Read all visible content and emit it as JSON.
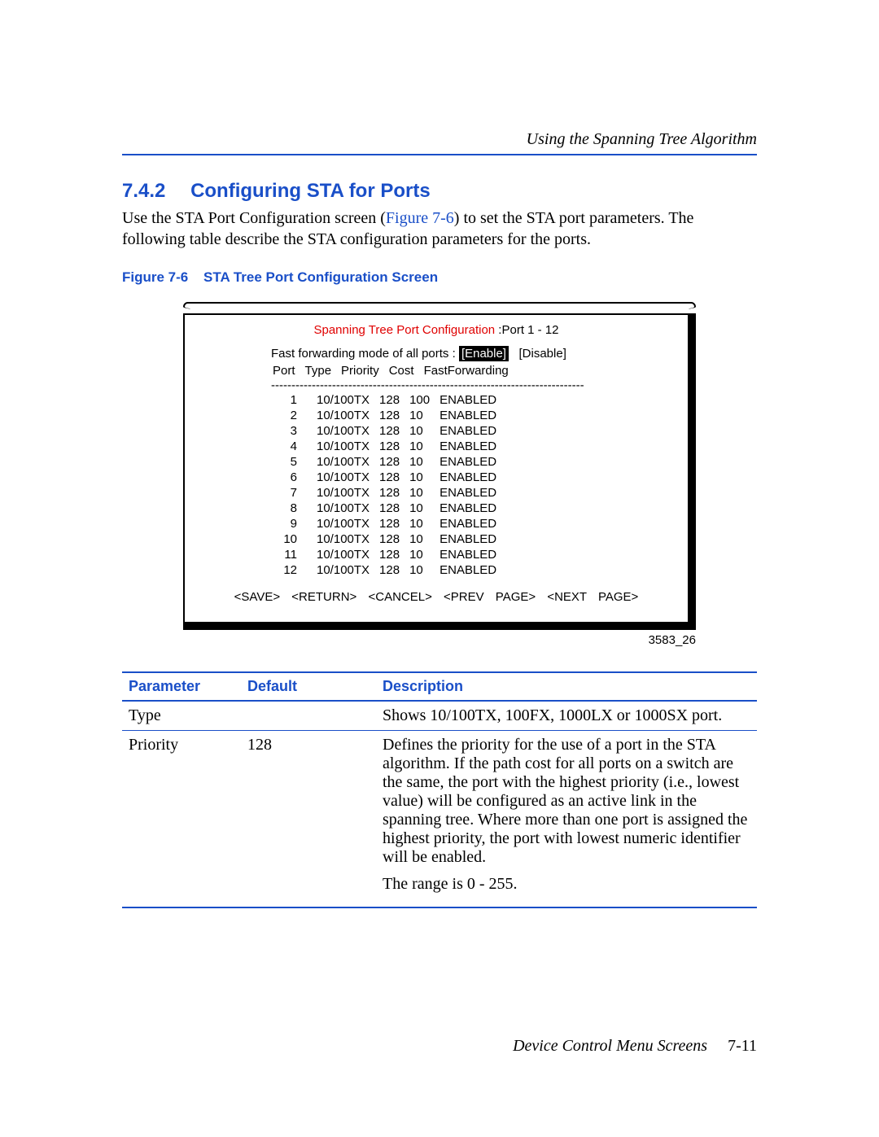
{
  "header": {
    "running": "Using the Spanning Tree Algorithm"
  },
  "section": {
    "number": "7.4.2",
    "title": "Configuring STA for Ports",
    "intro_pre": "Use the STA Port Configuration screen (",
    "intro_ref": "Figure 7-6",
    "intro_post": ") to set the STA port parameters. The following table describe the STA configuration parameters for the ports."
  },
  "figure": {
    "label_num": "Figure 7-6",
    "label_title": "STA Tree Port Configuration Screen",
    "title_red": "Spanning Tree Port Configuration",
    "title_suffix": " :Port  1 - 12",
    "ff_label": "Fast forwarding mode of all ports : ",
    "ff_enable": "[Enable]",
    "ff_disable": "[Disable]",
    "columns": [
      "Port",
      "Type",
      "Priority",
      "Cost",
      "FastForwarding"
    ],
    "rows": [
      {
        "port": "1",
        "type": "10/100TX",
        "priority": "128",
        "cost": "100",
        "ff": "ENABLED"
      },
      {
        "port": "2",
        "type": "10/100TX",
        "priority": "128",
        "cost": "10",
        "ff": "ENABLED"
      },
      {
        "port": "3",
        "type": "10/100TX",
        "priority": "128",
        "cost": "10",
        "ff": "ENABLED"
      },
      {
        "port": "4",
        "type": "10/100TX",
        "priority": "128",
        "cost": "10",
        "ff": "ENABLED"
      },
      {
        "port": "5",
        "type": "10/100TX",
        "priority": "128",
        "cost": "10",
        "ff": "ENABLED"
      },
      {
        "port": "6",
        "type": "10/100TX",
        "priority": "128",
        "cost": "10",
        "ff": "ENABLED"
      },
      {
        "port": "7",
        "type": "10/100TX",
        "priority": "128",
        "cost": "10",
        "ff": "ENABLED"
      },
      {
        "port": "8",
        "type": "10/100TX",
        "priority": "128",
        "cost": "10",
        "ff": "ENABLED"
      },
      {
        "port": "9",
        "type": "10/100TX",
        "priority": "128",
        "cost": "10",
        "ff": "ENABLED"
      },
      {
        "port": "10",
        "type": "10/100TX",
        "priority": "128",
        "cost": "10",
        "ff": "ENABLED"
      },
      {
        "port": "11",
        "type": "10/100TX",
        "priority": "128",
        "cost": "10",
        "ff": "ENABLED"
      },
      {
        "port": "12",
        "type": "10/100TX",
        "priority": "128",
        "cost": "10",
        "ff": "ENABLED"
      }
    ],
    "footer": {
      "save": "<SAVE>",
      "return": "<RETURN>",
      "cancel": "<CANCEL>",
      "prev": "<PREV PAGE>",
      "next": "<NEXT PAGE>"
    },
    "id": "3583_26"
  },
  "param_table": {
    "head": {
      "param": "Parameter",
      "default": "Default",
      "desc": "Description"
    },
    "rows": [
      {
        "param": "Type",
        "default": "",
        "desc": "Shows 10/100TX, 100FX, 1000LX or 1000SX port.",
        "desc2": ""
      },
      {
        "param": "Priority",
        "default": "128",
        "desc": "Defines the priority for the use of a port in the STA algorithm. If the path cost for all ports on a switch are the same, the port with the highest priority (i.e., lowest value) will be configured as an active link in the spanning tree. Where more than one port is assigned the highest priority, the port with lowest numeric identifier will be enabled.",
        "desc2": "The range is 0 - 255."
      }
    ]
  },
  "footer": {
    "title": "Device Control Menu Screens",
    "page": "7-11"
  }
}
